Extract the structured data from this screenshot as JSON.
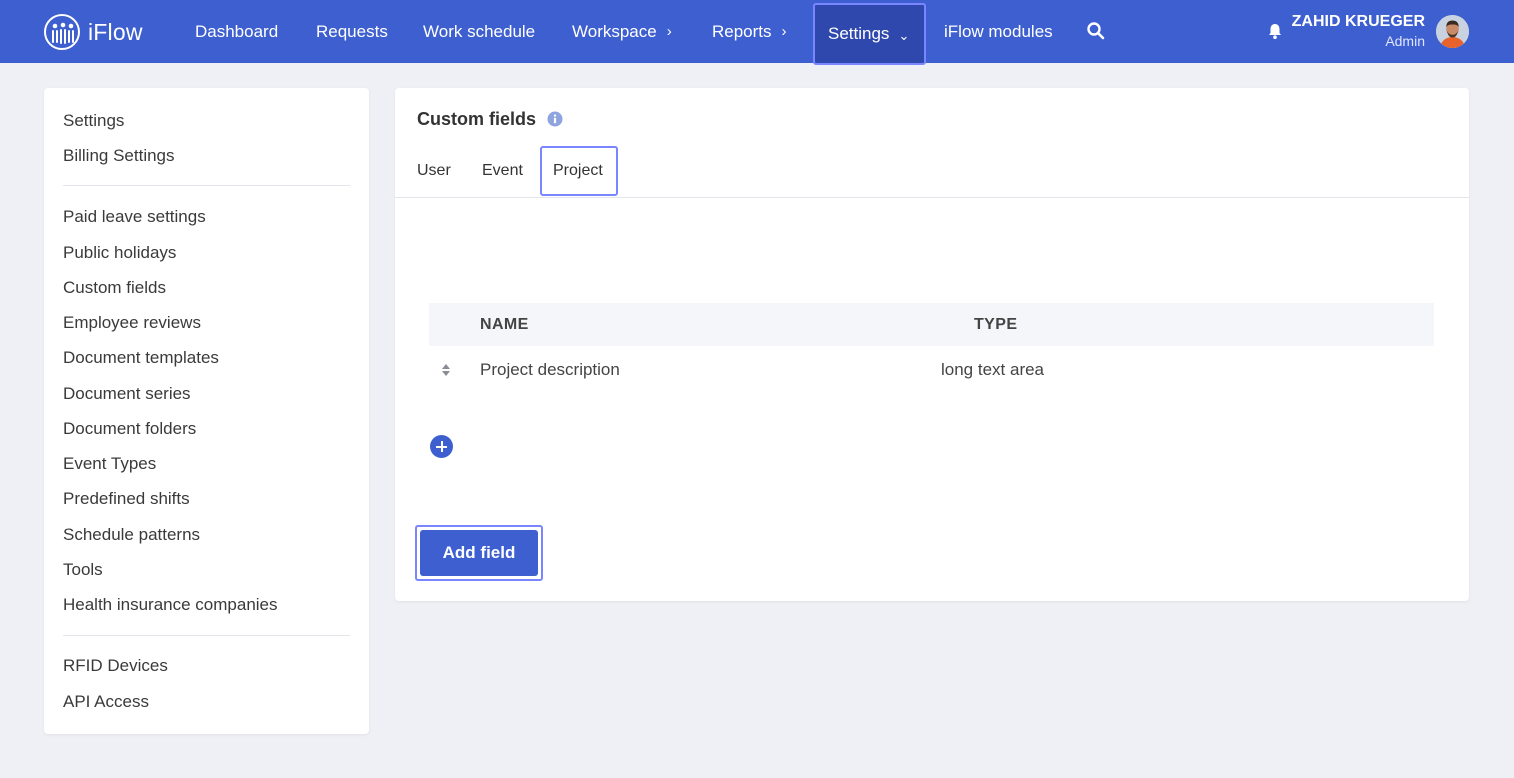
{
  "app": {
    "name": "iFlow"
  },
  "nav": {
    "items": [
      {
        "label": "Dashboard"
      },
      {
        "label": "Requests"
      },
      {
        "label": "Work schedule"
      },
      {
        "label": "Workspace"
      },
      {
        "label": "Reports"
      },
      {
        "label": "Settings"
      },
      {
        "label": "iFlow modules"
      }
    ]
  },
  "user": {
    "name": "ZAHID KRUEGER",
    "role": "Admin"
  },
  "sidebar": {
    "group1": [
      {
        "label": "Settings"
      },
      {
        "label": "Billing Settings"
      }
    ],
    "group2": [
      {
        "label": "Paid leave settings"
      },
      {
        "label": "Public holidays"
      },
      {
        "label": "Custom fields"
      },
      {
        "label": "Employee reviews"
      },
      {
        "label": "Document templates"
      },
      {
        "label": "Document series"
      },
      {
        "label": "Document folders"
      },
      {
        "label": "Event Types"
      },
      {
        "label": "Predefined shifts"
      },
      {
        "label": "Schedule patterns"
      },
      {
        "label": "Tools"
      },
      {
        "label": "Health insurance companies"
      }
    ],
    "group3": [
      {
        "label": "RFID Devices"
      },
      {
        "label": "API Access"
      }
    ]
  },
  "main": {
    "title": "Custom fields",
    "tabs": [
      {
        "label": "User"
      },
      {
        "label": "Event"
      },
      {
        "label": "Project"
      }
    ],
    "active_tab": "Project",
    "table": {
      "columns": [
        "NAME",
        "TYPE"
      ],
      "rows": [
        {
          "name": "Project description",
          "type": "long text area"
        }
      ]
    },
    "add_field_label": "Add field"
  },
  "colors": {
    "primary": "#3d5fcf",
    "focus_outline": "#7a86ff",
    "page_bg": "#eef0f5"
  },
  "icons": {
    "logo": "people-logo-icon",
    "search": "search-icon",
    "bell": "bell-icon",
    "info": "info-icon",
    "sort": "sort-icon",
    "add": "plus-circle-icon"
  }
}
